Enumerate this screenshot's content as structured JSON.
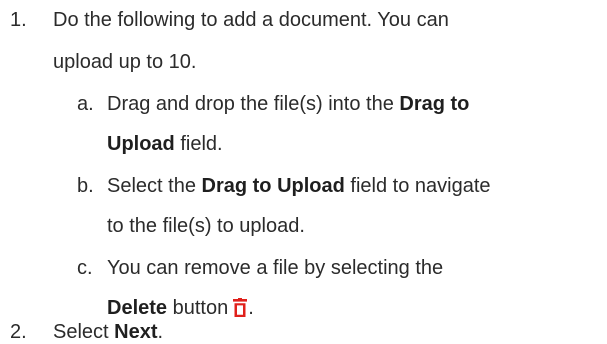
{
  "steps": [
    {
      "number": "1.",
      "line1": "Do the following to add a document. You can",
      "line2": "upload up to 10.",
      "substeps": [
        {
          "letter": "a.",
          "line1_pre": "Drag and drop the file(s) into the ",
          "line1_bold": "Drag to",
          "line2_bold": "Upload",
          "line2_post": " field."
        },
        {
          "letter": "b.",
          "line1_pre": "Select the ",
          "line1_bold": "Drag to Upload",
          "line1_post": " field to navigate",
          "line2": "to the file(s) to upload."
        },
        {
          "letter": "c.",
          "line1": "You can remove a file by selecting the",
          "line2_bold": "Delete",
          "line2_post": " button",
          "icon": "trash-icon",
          "trailing": "."
        }
      ]
    },
    {
      "number": "2.",
      "pre": "Select ",
      "bold": "Next",
      "post": "."
    }
  ],
  "colors": {
    "text": "#2b2b2b",
    "icon": "#e0201b"
  }
}
